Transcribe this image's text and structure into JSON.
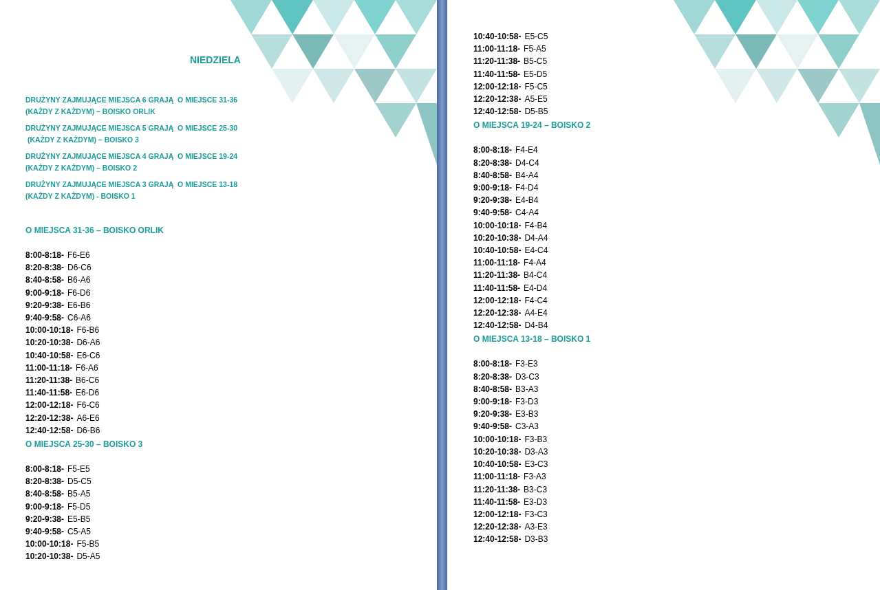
{
  "pages": [
    {
      "title": "NIEDZIELA",
      "intro": [
        "DRUŻYNY ZAJMUJĄCE MIEJSCA 6 GRAJĄ  O MIEJSCE 31-36\n(KAŻDY Z KAŻDYM) – BOISKO ORLIK",
        "DRUŻYNY ZAJMUJĄCE MIEJSCA 5 GRAJĄ  O MIEJSCE 25-30\n (KAŻDY Z KAŻDYM) – BOISKO 3",
        "DRUŻYNY ZAJMUJĄCE MIEJSCA 4 GRAJĄ  O MIEJSCE 19-24\n(KAŻDY Z KAŻDYM) – BOISKO 2",
        "DRUŻYNY ZAJMUJĄCE MIEJSCA 3 GRAJĄ  O MIEJSCE 13-18\n(KAŻDY Z KAŻDYM) - BOISKO 1"
      ],
      "sections": [
        {
          "heading": "O MIEJSCA 31-36  – BOISKO ORLIK",
          "matches": [
            {
              "time": "8:00-8:18-",
              "pair": "F6-E6"
            },
            {
              "time": "8:20-8:38-",
              "pair": "D6-C6"
            },
            {
              "time": "8:40-8:58-",
              "pair": "B6-A6"
            },
            {
              "time": "9:00-9:18-",
              "pair": "F6-D6"
            },
            {
              "time": "9:20-9:38-",
              "pair": "E6-B6"
            },
            {
              "time": "9:40-9:58-",
              "pair": "C6-A6"
            },
            {
              "time": "10:00-10:18-",
              "pair": "F6-B6"
            },
            {
              "time": "10:20-10:38-",
              "pair": "D6-A6"
            },
            {
              "time": "10:40-10:58-",
              "pair": "E6-C6"
            },
            {
              "time": "11:00-11:18-",
              "pair": "F6-A6"
            },
            {
              "time": "11:20-11:38-",
              "pair": "B6-C6"
            },
            {
              "time": "11:40-11:58-",
              "pair": "E6-D6"
            },
            {
              "time": "12:00-12:18-",
              "pair": "F6-C6"
            },
            {
              "time": "12:20-12:38-",
              "pair": "A6-E6"
            },
            {
              "time": "12:40-12:58-",
              "pair": "D6-B6"
            }
          ]
        },
        {
          "heading": "O MIEJSCA 25-30  – BOISKO 3",
          "matches": [
            {
              "time": "8:00-8:18-",
              "pair": "F5-E5"
            },
            {
              "time": "8:20-8:38-",
              "pair": "D5-C5"
            },
            {
              "time": "8:40-8:58-",
              "pair": "B5-A5"
            },
            {
              "time": "9:00-9:18-",
              "pair": "F5-D5"
            },
            {
              "time": "9:20-9:38-",
              "pair": "E5-B5"
            },
            {
              "time": "9:40-9:58-",
              "pair": "C5-A5"
            },
            {
              "time": "10:00-10:18-",
              "pair": "F5-B5"
            },
            {
              "time": "10:20-10:38-",
              "pair": "D5-A5"
            }
          ]
        }
      ]
    },
    {
      "sections": [
        {
          "matches": [
            {
              "time": "10:40-10:58-",
              "pair": "E5-C5"
            },
            {
              "time": "11:00-11:18-",
              "pair": "F5-A5"
            },
            {
              "time": "11:20-11:38-",
              "pair": "B5-C5"
            },
            {
              "time": "11:40-11:58-",
              "pair": "E5-D5"
            },
            {
              "time": "12:00-12:18-",
              "pair": "F5-C5"
            },
            {
              "time": "12:20-12:38-",
              "pair": "A5-E5"
            },
            {
              "time": "12:40-12:58-",
              "pair": "D5-B5"
            }
          ]
        },
        {
          "heading": "O MIEJSCA 19-24  – BOISKO 2",
          "matches": [
            {
              "time": "8:00-8:18-",
              "pair": "F4-E4"
            },
            {
              "time": "8:20-8:38-",
              "pair": "D4-C4"
            },
            {
              "time": "8:40-8:58-",
              "pair": "B4-A4"
            },
            {
              "time": "9:00-9:18-",
              "pair": "F4-D4"
            },
            {
              "time": "9:20-9:38-",
              "pair": "E4-B4"
            },
            {
              "time": "9:40-9:58-",
              "pair": "C4-A4"
            },
            {
              "time": "10:00-10:18-",
              "pair": "F4-B4"
            },
            {
              "time": "10:20-10:38-",
              "pair": "D4-A4"
            },
            {
              "time": "10:40-10:58-",
              "pair": "E4-C4"
            },
            {
              "time": "11:00-11:18-",
              "pair": "F4-A4"
            },
            {
              "time": "11:20-11:38-",
              "pair": "B4-C4"
            },
            {
              "time": "11:40-11:58-",
              "pair": "E4-D4"
            },
            {
              "time": "12:00-12:18-",
              "pair": "F4-C4"
            },
            {
              "time": "12:20-12:38-",
              "pair": "A4-E4"
            },
            {
              "time": "12:40-12:58-",
              "pair": "D4-B4"
            }
          ]
        },
        {
          "heading": "O MIEJSCA 13-18  – BOISKO 1",
          "matches": [
            {
              "time": "8:00-8:18-",
              "pair": "F3-E3"
            },
            {
              "time": "8:20-8:38-",
              "pair": "D3-C3"
            },
            {
              "time": "8:40-8:58-",
              "pair": "B3-A3"
            },
            {
              "time": "9:00-9:18-",
              "pair": "F3-D3"
            },
            {
              "time": "9:20-9:38-",
              "pair": "E3-B3"
            },
            {
              "time": "9:40-9:58-",
              "pair": "C3-A3"
            },
            {
              "time": "10:00-10:18-",
              "pair": "F3-B3"
            },
            {
              "time": "10:20-10:38-",
              "pair": "D3-A3"
            },
            {
              "time": "10:40-10:58-",
              "pair": "E3-C3"
            },
            {
              "time": "11:00-11:18-",
              "pair": "F3-A3"
            },
            {
              "time": "11:20-11:38-",
              "pair": "B3-C3"
            },
            {
              "time": "11:40-11:58-",
              "pair": "E3-D3"
            },
            {
              "time": "12:00-12:18-",
              "pair": "F3-C3"
            },
            {
              "time": "12:20-12:38-",
              "pair": "A3-E3"
            },
            {
              "time": "12:40-12:58-",
              "pair": "D3-B3"
            }
          ]
        }
      ]
    }
  ]
}
